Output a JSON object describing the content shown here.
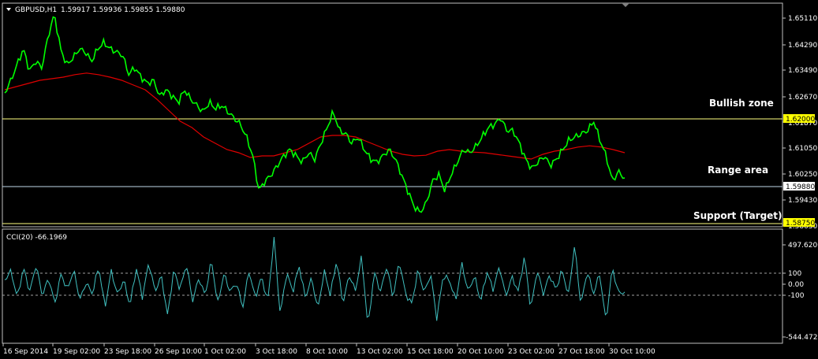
{
  "header": {
    "symbol": "GBPUSD,H1",
    "ohlc": "1.59917 1.59936 1.59855 1.59880"
  },
  "price_axis": {
    "ticks": [
      "1.65110",
      "1.64290",
      "1.63490",
      "1.62670",
      "1.61870",
      "1.61050",
      "1.60250",
      "1.59430",
      "1.58630"
    ],
    "highlight_labels": [
      {
        "text": "1.62000",
        "fill": "#ffff00",
        "color": "#000000"
      },
      {
        "text": "1.59880",
        "fill": "#ffffff",
        "color": "#000000"
      },
      {
        "text": "1.58750",
        "fill": "#ffff00",
        "color": "#000000"
      }
    ]
  },
  "annotations": [
    "Bullish zone",
    "Range area",
    "Support (Target)"
  ],
  "indicator": {
    "title": "CCI(20) -66.1969",
    "ticks": [
      "497.6206",
      "100",
      "0.00",
      "-100",
      "-544.4729"
    ]
  },
  "time_axis": [
    "16 Sep 2014",
    "19 Sep 02:00",
    "23 Sep 18:00",
    "26 Sep 10:00",
    "1 Oct 02:00",
    "3 Oct 18:00",
    "8 Oct 10:00",
    "13 Oct 02:00",
    "15 Oct 18:00",
    "20 Oct 10:00",
    "23 Oct 02:00",
    "27 Oct 18:00",
    "30 Oct 10:00"
  ],
  "colors": {
    "background": "#000000",
    "price_line": "#00ff00",
    "moving_average": "#e00000",
    "cci_line": "#40c0c0",
    "zone_line": "#ffff80",
    "current_line": "#c0d8e8",
    "frame": "#c0c0c0"
  },
  "chart_data": {
    "type": "line",
    "series": [
      {
        "values": [
          1.626,
          1.63,
          1.635,
          1.64,
          1.633,
          1.636,
          1.634,
          1.644,
          1.651,
          1.64,
          1.635,
          1.637,
          1.64,
          1.639,
          1.636,
          1.64,
          1.642,
          1.64,
          1.639,
          1.638,
          1.632,
          1.634,
          1.631,
          1.629,
          1.63,
          1.625,
          1.627,
          1.625,
          1.623,
          1.627,
          1.624,
          1.622,
          1.62,
          1.623,
          1.621,
          1.622,
          1.62,
          1.618,
          1.616,
          1.612,
          1.606,
          1.595,
          1.598,
          1.6,
          1.603,
          1.606,
          1.608,
          1.606,
          1.604,
          1.607,
          1.605,
          1.61,
          1.615,
          1.62,
          1.614,
          1.613,
          1.61,
          1.612,
          1.608,
          1.605,
          1.604,
          1.606,
          1.608,
          1.605,
          1.6,
          1.595,
          1.59,
          1.588,
          1.591,
          1.598,
          1.6,
          1.595,
          1.6,
          1.604,
          1.608,
          1.607,
          1.609,
          1.612,
          1.615,
          1.616,
          1.618,
          1.614,
          1.614,
          1.61,
          1.605,
          1.602,
          1.604,
          1.606,
          1.603,
          1.605,
          1.608,
          1.611,
          1.612,
          1.613,
          1.614,
          1.617,
          1.611,
          1.606,
          1.598,
          1.601,
          1.5988
        ]
      },
      {
        "values": [
          1.627,
          1.628,
          1.629,
          1.63,
          1.6305,
          1.631,
          1.6318,
          1.6323,
          1.6318,
          1.631,
          1.63,
          1.6285,
          1.627,
          1.624,
          1.6205,
          1.617,
          1.615,
          1.612,
          1.61,
          1.608,
          1.607,
          1.6055,
          1.606,
          1.606,
          1.607,
          1.608,
          1.61,
          1.612,
          1.6125,
          1.6125,
          1.612,
          1.6105,
          1.609,
          1.6075,
          1.6065,
          1.606,
          1.6062,
          1.6075,
          1.608,
          1.6075,
          1.6072,
          1.607,
          1.6065,
          1.606,
          1.6055,
          1.605,
          1.6065,
          1.6075,
          1.608,
          1.6088,
          1.6092,
          1.6088,
          1.608,
          1.607
        ]
      },
      {
        "values": [
          60,
          150,
          -120,
          180,
          -60,
          210,
          -100,
          80,
          -180,
          120,
          -40,
          160,
          -140,
          30,
          -80,
          200,
          -220,
          150,
          -90,
          60,
          -200,
          180,
          -120,
          240,
          -60,
          100,
          -300,
          160,
          -40,
          220,
          -150,
          80,
          -100,
          260,
          -180,
          120,
          -60,
          30,
          -220,
          150,
          -120,
          90,
          -160,
          480,
          -300,
          140,
          -60,
          200,
          -120,
          80,
          -240,
          150,
          -90,
          260,
          -180,
          110,
          -50,
          300,
          -420,
          140,
          -60,
          200,
          -120,
          250,
          -80,
          -180,
          160,
          -70,
          120,
          -330,
          100,
          60,
          -150,
          220,
          -60,
          100,
          -160,
          140,
          -40,
          200,
          -110,
          90,
          -60,
          300,
          -240,
          160,
          -80,
          110,
          -40,
          160,
          -100,
          410,
          -200,
          150,
          -80,
          120,
          -360,
          180,
          -70,
          -66
        ]
      }
    ],
    "ylim": [
      1.584,
      1.654
    ],
    "cci_ylim": [
      -544.4729,
      497.6206
    ]
  }
}
